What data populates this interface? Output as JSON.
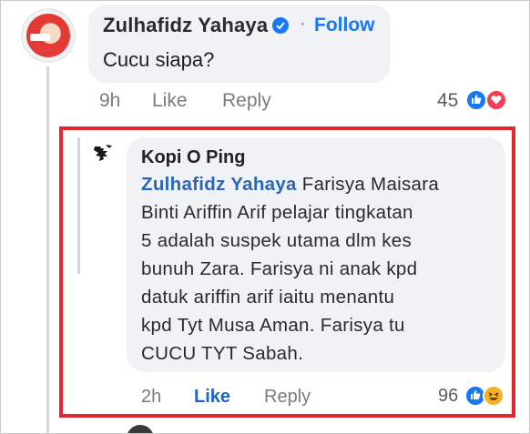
{
  "comment": {
    "author": "Zulhafidz Yahaya",
    "follow_label": "Follow",
    "separator": "·",
    "text": "Cucu siapa?",
    "time": "9h",
    "like_label": "Like",
    "reply_label": "Reply",
    "reaction_count": "45",
    "reactions": [
      "like-icon",
      "love-icon"
    ]
  },
  "reply": {
    "author": "Kopi O Ping",
    "mention": "Zulhafidz Yahaya",
    "lines": [
      " Farisya Maisara",
      "Binti Ariffin Arif pelajar tingkatan",
      "5 adalah suspek utama dlm kes",
      "bunuh Zara. Farisya ni anak kpd",
      "datuk ariffin arif iaitu menantu",
      "kpd Tyt Musa Aman. Farisya tu",
      "CUCU TYT Sabah."
    ],
    "time": "2h",
    "like_label": "Like",
    "reply_label": "Reply",
    "reaction_count": "96",
    "reactions": [
      "like-icon",
      "haha-icon"
    ]
  },
  "colors": {
    "accent": "#1877f2",
    "highlight_border": "#e0282e",
    "bubble": "#f0f2f5"
  }
}
